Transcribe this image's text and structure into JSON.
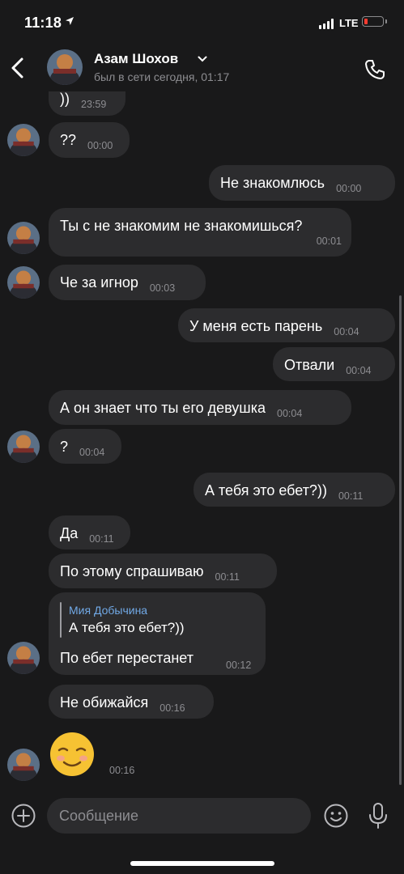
{
  "status_bar": {
    "time": "11:18",
    "network": "LTE"
  },
  "header": {
    "contact_name": "Азам Шохов",
    "last_seen": "был в сети сегодня, 01:17"
  },
  "messages": [
    {
      "dir": "in",
      "text": "))",
      "time": "23:59"
    },
    {
      "dir": "in",
      "text": "??",
      "time": "00:00"
    },
    {
      "dir": "out",
      "text": "Не знакомлюсь",
      "time": "00:00"
    },
    {
      "dir": "in",
      "text": "Ты с не знакомим не знакомишься?",
      "time": "00:01"
    },
    {
      "dir": "in",
      "text": "Че за игнор",
      "time": "00:03"
    },
    {
      "dir": "out",
      "text": "У меня есть парень",
      "time": "00:04"
    },
    {
      "dir": "out",
      "text": "Отвали",
      "time": "00:04"
    },
    {
      "dir": "in",
      "text": "А он знает что ты его девушка",
      "time": "00:04"
    },
    {
      "dir": "in",
      "text": "?",
      "time": "00:04"
    },
    {
      "dir": "out",
      "text": "А тебя это ебет?))",
      "time": "00:11"
    },
    {
      "dir": "in",
      "text": "Да",
      "time": "00:11"
    },
    {
      "dir": "in",
      "text": "По этому спрашиваю",
      "time": "00:11"
    },
    {
      "dir": "in",
      "reply_to_name": "Мия Добычина",
      "reply_to_text": "А тебя это ебет?))",
      "text": "По ебет перестанет",
      "time": "00:12"
    },
    {
      "dir": "in",
      "text": "Не обижайся",
      "time": "00:16"
    },
    {
      "dir": "in",
      "emoji": "☺",
      "time": "00:16"
    }
  ],
  "composer": {
    "placeholder": "Сообщение"
  }
}
